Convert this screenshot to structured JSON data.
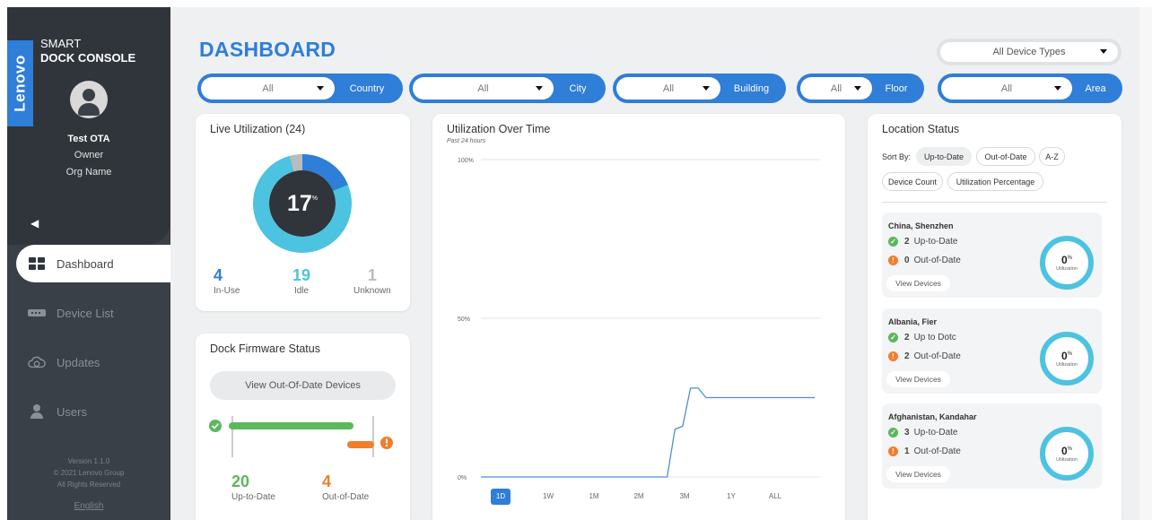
{
  "app": {
    "brand": "Lenovo",
    "title_line1": "SMART",
    "title_line2": "DOCK CONSOLE"
  },
  "user": {
    "name": "Test OTA",
    "role": "Owner",
    "org": "Org Name"
  },
  "sidebar": {
    "collapse_icon": "chevron-left-icon",
    "items": [
      {
        "label": "Dashboard",
        "icon": "dashboard-icon",
        "active": true
      },
      {
        "label": "Device List",
        "icon": "dock-icon",
        "active": false
      },
      {
        "label": "Updates",
        "icon": "cloud-update-icon",
        "active": false
      },
      {
        "label": "Users",
        "icon": "user-icon",
        "active": false
      }
    ],
    "version": "Version 1.1.0",
    "copyright": "© 2021 Lenovo Group",
    "rights": "All Rights Reserved",
    "language": "English"
  },
  "header": {
    "title": "DASHBOARD",
    "device_type": "All Device Types"
  },
  "filters": [
    {
      "value": "All",
      "label": "Country"
    },
    {
      "value": "All",
      "label": "City"
    },
    {
      "value": "All",
      "label": "Building"
    },
    {
      "value": "All",
      "label": "Floor"
    },
    {
      "value": "All",
      "label": "Area"
    }
  ],
  "live_utilization": {
    "title": "Live Utilization (24)",
    "percent": "17",
    "percent_sign": "%",
    "in_use": {
      "value": "4",
      "label": "In-Use"
    },
    "idle": {
      "value": "19",
      "label": "Idle"
    },
    "unknown": {
      "value": "1",
      "label": "Unknown"
    }
  },
  "firmware": {
    "title": "Dock Firmware Status",
    "button": "View Out-Of-Date Devices",
    "up_to_date": {
      "value": "20",
      "label": "Up-to-Date"
    },
    "out_of_date": {
      "value": "4",
      "label": "Out-of-Date"
    }
  },
  "utilization_over_time": {
    "title": "Utilization Over Time",
    "subtitle": "Past 24 hours",
    "ranges": [
      "1D",
      "1W",
      "1M",
      "2M",
      "3M",
      "1Y",
      "ALL"
    ],
    "active_range": "1D"
  },
  "chart_data": {
    "type": "line",
    "title": "Utilization Over Time",
    "subtitle": "Past 24 hours",
    "ylabels": [
      "100%",
      "50%",
      "0%"
    ],
    "ylim": [
      0,
      100
    ],
    "grid": true,
    "series": [
      {
        "color": "#4a90d9",
        "values": [
          0,
          0,
          0,
          0,
          0,
          0,
          0,
          0,
          0,
          0,
          0,
          0,
          0,
          0,
          0,
          0,
          0,
          0,
          0,
          0,
          0,
          0,
          0,
          0,
          0,
          15,
          16,
          28,
          28,
          25,
          25,
          25,
          25,
          25,
          25,
          25,
          25,
          25,
          25,
          25,
          25,
          25,
          25,
          25
        ]
      }
    ]
  },
  "location_status": {
    "title": "Location Status",
    "sort_label": "Sort By:",
    "sort_options": [
      "Up-to-Date",
      "Out-of-Date",
      "A-Z",
      "Device Count",
      "Utilization Percentage"
    ],
    "active_sort": "Up-to-Date",
    "locations": [
      {
        "name": "China, Shenzhen",
        "up_count": "2",
        "up_label": "Up-to-Date",
        "out_count": "0",
        "out_label": "Out-of-Date",
        "view": "View Devices",
        "util": "0",
        "util_sign": "%",
        "util_label": "Utilization"
      },
      {
        "name": "Albania, Fier",
        "up_count": "2",
        "up_label": "Up to Dotc",
        "out_count": "2",
        "out_label": "Out-of-Date",
        "view": "View Devices",
        "util": "0",
        "util_sign": "%",
        "util_label": "Utilization"
      },
      {
        "name": "Afghanistan, Kandahar",
        "up_count": "3",
        "up_label": "Up-to-Date",
        "out_count": "1",
        "out_label": "Out-of-Date",
        "view": "View Devices",
        "util": "0",
        "util_sign": "%",
        "util_label": "Utilization"
      }
    ]
  },
  "colors": {
    "accent": "#2f7ed8",
    "sidebar": "#3a4047",
    "idle": "#4cc3e0",
    "in_use": "#2f7ed8",
    "unknown": "#b8bcc0",
    "ok": "#5cb85c",
    "warn": "#f07e2a"
  }
}
